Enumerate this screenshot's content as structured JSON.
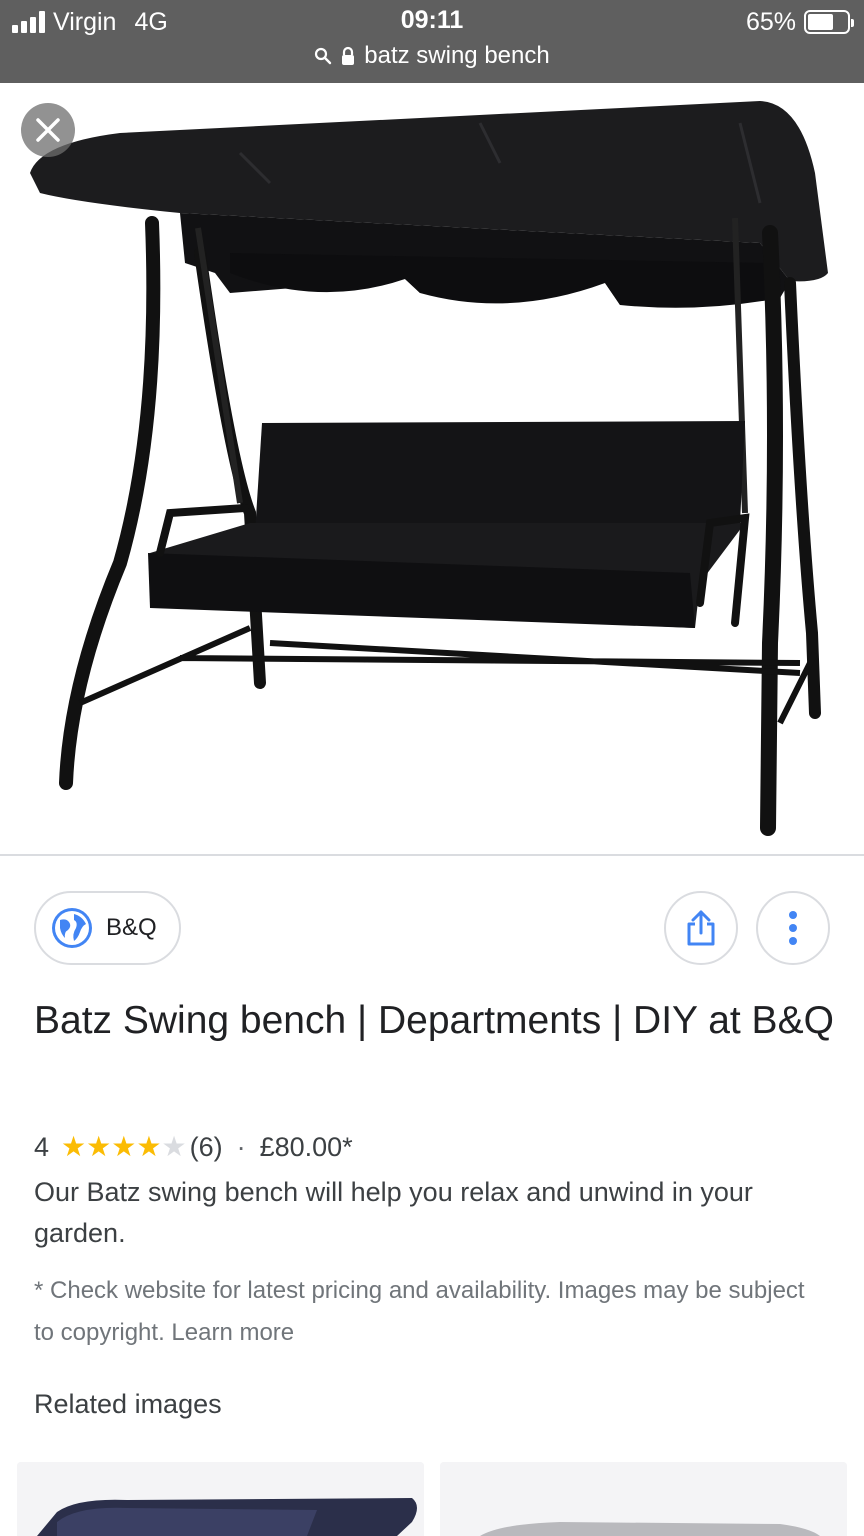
{
  "status_bar": {
    "carrier": "Virgin",
    "network": "4G",
    "time": "09:11",
    "battery": "65%",
    "battery_level": 0.65
  },
  "url_bar": {
    "query": "batz swing bench"
  },
  "result": {
    "source": "B&Q",
    "title": "Batz Swing bench | Departments | DIY at B&Q",
    "rating": "4",
    "rating_value": 4,
    "rating_max": 5,
    "review_count": "(6)",
    "separator": "·",
    "price": "£80.00*",
    "description": "Our Batz swing bench will help you relax and unwind in your garden.",
    "disclaimer": "* Check website for latest pricing and availability. Images may be subject to copyright.",
    "learn_more": "Learn more"
  },
  "related": {
    "heading": "Related images"
  },
  "colors": {
    "status_bar_bg": "#5f5f5f",
    "star": "#fbbc04",
    "link_icon_blue": "#4285f4"
  },
  "icons": {
    "close": "close-icon",
    "share": "share-icon",
    "more": "more-vert-icon",
    "globe": "globe-icon",
    "search": "search-icon",
    "lock": "lock-icon"
  }
}
